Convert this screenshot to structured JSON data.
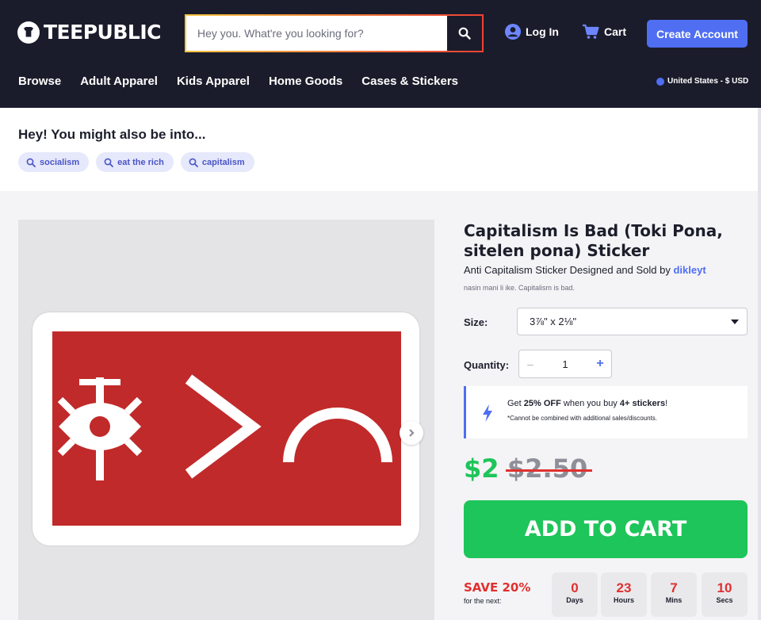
{
  "header": {
    "logo_text": "TEEPUBLIC",
    "search_placeholder": "Hey you. What're you looking for?",
    "login_label": "Log In",
    "cart_label": "Cart",
    "create_account_label": "Create Account",
    "nav": [
      "Browse",
      "Adult Apparel",
      "Kids Apparel",
      "Home Goods",
      "Cases & Stickers"
    ],
    "locale": "United States - $ USD"
  },
  "suggestions": {
    "title": "Hey! You might also be into...",
    "chips": [
      "socialism",
      "eat the rich",
      "capitalism"
    ]
  },
  "product": {
    "title": "Capitalism Is Bad (Toki Pona, sitelen pona) Sticker",
    "subtitle_prefix": "Anti Capitalism Sticker Designed and Sold by ",
    "designer": "dikleyt",
    "description": "nasin mani li ike. Capitalism is bad.",
    "size_label": "Size:",
    "size_value": "3⅞\" x 2⅛\"",
    "quantity_label": "Quantity:",
    "quantity_value": "1",
    "promo_line1_a": "Get ",
    "promo_line1_b": "25% OFF",
    "promo_line1_c": " when you buy ",
    "promo_line1_d": "4+ stickers",
    "promo_line1_e": "!",
    "promo_line2": "*Cannot be combined with additional sales/discounts.",
    "price": "$2",
    "old_price": "$2.50",
    "add_to_cart": "ADD TO CART"
  },
  "countdown": {
    "save_label": "SAVE 20%",
    "save_sub": "for the next:",
    "units": [
      {
        "value": "0",
        "unit": "Days"
      },
      {
        "value": "23",
        "unit": "Hours"
      },
      {
        "value": "7",
        "unit": "Mins"
      },
      {
        "value": "10",
        "unit": "Secs"
      }
    ]
  },
  "colors": {
    "header_bg": "#1b1c2b",
    "accent_blue": "#4f6ef2",
    "price_green": "#1ec55a",
    "sale_red": "#e0302f",
    "sticker_red": "#c12a2a"
  }
}
